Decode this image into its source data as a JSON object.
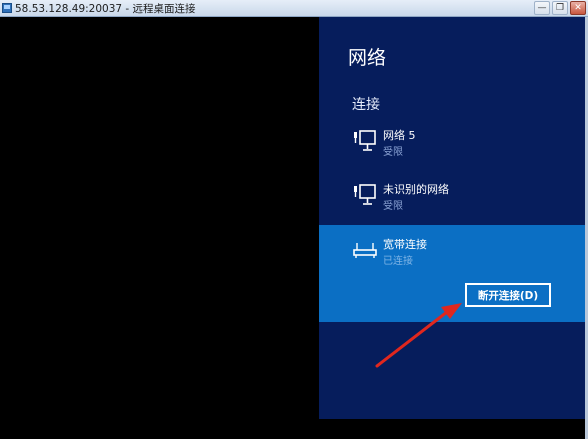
{
  "window": {
    "title": "58.53.128.49:20037 - 远程桌面连接",
    "minimize_glyph": "—",
    "restore_glyph": "❐",
    "close_glyph": "✕"
  },
  "charm": {
    "title": "网络",
    "section": "连接",
    "networks": [
      {
        "name": "网络  5",
        "status": "受限",
        "icon": "wired-network-icon"
      },
      {
        "name": "未识别的网络",
        "status": "受限",
        "icon": "wired-network-icon"
      },
      {
        "name": "宽带连接",
        "status": "已连接",
        "icon": "broadband-icon",
        "selected": true
      }
    ],
    "disconnect_label": "断开连接(D)"
  },
  "colors": {
    "charm_bg": "#061d5c",
    "selected_bg": "#0b6fc4",
    "arrow": "#e0271e"
  }
}
